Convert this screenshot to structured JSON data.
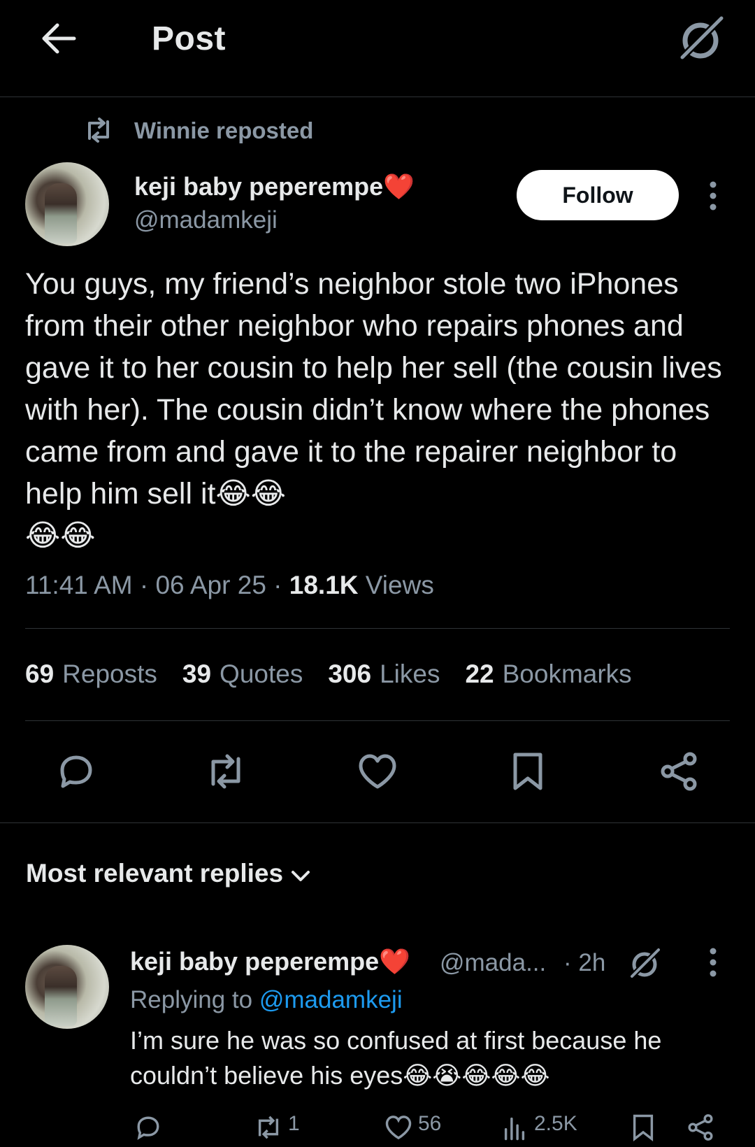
{
  "header": {
    "title": "Post",
    "icons": [
      "back-arrow-icon",
      "grok-icon"
    ]
  },
  "repost_banner": {
    "text": "Winnie reposted"
  },
  "post": {
    "author_name": "keji baby peperempe❤️",
    "author_handle": "@madamkeji",
    "follow_label": "Follow",
    "text": "You guys, my friend’s neighbor stole two iPhones from their other neighbor who repairs phones and gave it to her cousin to help her sell (the cousin lives with her). The cousin didn’t know where the phones came from and gave it to the repairer neighbor to help him sell it😂😂\n😂😂",
    "time": "11:41 AM",
    "date": "06 Apr 25",
    "views_count": "18.1K",
    "views_label": "Views",
    "separator": "·"
  },
  "stats": {
    "reposts": {
      "count": "69",
      "label": "Reposts"
    },
    "quotes": {
      "count": "39",
      "label": "Quotes"
    },
    "likes": {
      "count": "306",
      "label": "Likes"
    },
    "bookmarks": {
      "count": "22",
      "label": "Bookmarks"
    }
  },
  "replies_section": {
    "sort_label": "Most relevant replies"
  },
  "reply": {
    "author_name": "keji baby peperempe❤️",
    "author_handle": "@mada...",
    "time": "· 2h",
    "replying_prefix": "Replying to",
    "replying_handle": "@madamkeji",
    "text": "I’m sure he was so confused at first because he couldn’t believe his eyes😂😭😂😂😂",
    "actions": {
      "reposts": "1",
      "likes": "56",
      "views": "2.5K"
    }
  },
  "colors": {
    "background": "#000000",
    "text_primary": "#e7e9ea",
    "text_secondary": "#8b98a5",
    "link": "#1d9bf0",
    "divider": "#2f3336"
  }
}
